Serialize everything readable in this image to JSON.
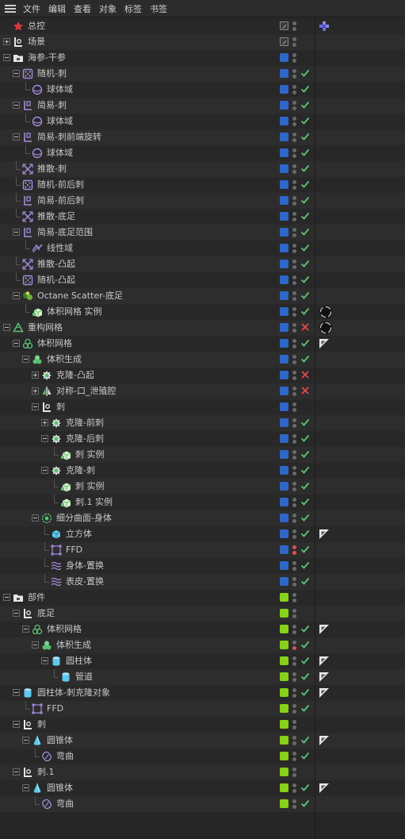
{
  "menu": [
    "文件",
    "编辑",
    "查看",
    "对象",
    "标签",
    "书签"
  ],
  "colors": {
    "layer_blue": "#2f67c8",
    "layer_green": "#88d11a",
    "check_green": "#58c878",
    "cross_red": "#e24b4b",
    "dot_red": "#e05050",
    "icon_purple": "#a58bdc",
    "icon_green": "#58c070",
    "icon_cyan": "#5ec9ee",
    "icon_red": "#d83a3a"
  },
  "rows": [
    {
      "label": "总控",
      "depth": 0,
      "exp": "none",
      "icon": "star-icon",
      "layer": "flag",
      "check": "none",
      "tag": "tag-dots-icon"
    },
    {
      "label": "场景",
      "depth": 0,
      "exp": "plus",
      "icon": "null-object-icon",
      "layer": "flag",
      "check": "none",
      "tag": ""
    },
    {
      "label": "海参-干参",
      "depth": 0,
      "exp": "minus",
      "icon": "folder-icon",
      "layer": "blue",
      "check": "none",
      "tag": ""
    },
    {
      "label": "随机-刺",
      "depth": 1,
      "exp": "minus",
      "icon": "random-effector-icon",
      "layer": "blue",
      "check": "check",
      "tag": ""
    },
    {
      "label": "球体域",
      "depth": 2,
      "exp": "none",
      "icon": "sphere-field-icon",
      "layer": "blue",
      "check": "check",
      "tag": ""
    },
    {
      "label": "简易-刺",
      "depth": 1,
      "exp": "minus",
      "icon": "plain-effector-icon",
      "layer": "blue",
      "check": "check",
      "tag": ""
    },
    {
      "label": "球体域",
      "depth": 2,
      "exp": "none",
      "icon": "sphere-field-icon",
      "layer": "blue",
      "check": "check",
      "tag": ""
    },
    {
      "label": "简易-刺前端旋转",
      "depth": 1,
      "exp": "minus",
      "icon": "plain-effector-icon",
      "layer": "blue",
      "check": "check",
      "tag": ""
    },
    {
      "label": "球体域",
      "depth": 2,
      "exp": "none",
      "icon": "sphere-field-icon",
      "layer": "blue",
      "check": "check",
      "tag": ""
    },
    {
      "label": "推散-刺",
      "depth": 1,
      "exp": "none",
      "icon": "push-apart-icon",
      "layer": "blue",
      "check": "check",
      "tag": ""
    },
    {
      "label": "随机-前后刺",
      "depth": 1,
      "exp": "none",
      "icon": "random-effector-icon",
      "layer": "blue",
      "check": "check",
      "tag": ""
    },
    {
      "label": "简易-前后刺",
      "depth": 1,
      "exp": "none",
      "icon": "plain-effector-icon",
      "layer": "blue",
      "check": "check",
      "tag": ""
    },
    {
      "label": "推散-底足",
      "depth": 1,
      "exp": "none",
      "icon": "push-apart-icon",
      "layer": "blue",
      "check": "check",
      "tag": ""
    },
    {
      "label": "简易-底足范围",
      "depth": 1,
      "exp": "minus",
      "icon": "plain-effector-icon",
      "layer": "blue",
      "check": "check",
      "tag": ""
    },
    {
      "label": "线性域",
      "depth": 2,
      "exp": "none",
      "icon": "linear-field-icon",
      "layer": "blue",
      "check": "check",
      "tag": ""
    },
    {
      "label": "推散-凸起",
      "depth": 1,
      "exp": "none",
      "icon": "push-apart-icon",
      "layer": "blue",
      "check": "check",
      "tag": ""
    },
    {
      "label": "随机-凸起",
      "depth": 1,
      "exp": "none",
      "icon": "random-effector-icon",
      "layer": "blue",
      "check": "check",
      "tag": ""
    },
    {
      "label": "Octane Scatter-底足",
      "depth": 1,
      "exp": "minus",
      "icon": "octane-scatter-icon",
      "layer": "blue",
      "check": "check",
      "tag": ""
    },
    {
      "label": "体积网格 实例",
      "depth": 2,
      "exp": "none",
      "icon": "instance-icon",
      "layer": "blue",
      "check": "check",
      "tag": "octane-object-tag-icon"
    },
    {
      "label": "重构网格",
      "depth": 0,
      "exp": "minus",
      "icon": "remesh-icon",
      "layer": "blue",
      "check": "cross",
      "tag": "octane-object-tag-icon"
    },
    {
      "label": "体积网格",
      "depth": 1,
      "exp": "minus",
      "icon": "volume-mesher-icon",
      "layer": "blue",
      "check": "check",
      "tag": "phong-tag-icon"
    },
    {
      "label": "体积生成",
      "depth": 2,
      "exp": "minus",
      "icon": "volume-builder-icon",
      "layer": "blue",
      "check": "check",
      "tag": ""
    },
    {
      "label": "克隆-凸起",
      "depth": 3,
      "exp": "plus",
      "icon": "cloner-icon",
      "layer": "blue",
      "check": "cross",
      "tag": ""
    },
    {
      "label": "对称-口_泄殖腔",
      "depth": 3,
      "exp": "plus",
      "icon": "symmetry-icon",
      "layer": "blue",
      "check": "cross",
      "tag": ""
    },
    {
      "label": "刺",
      "depth": 3,
      "exp": "minus",
      "icon": "null-object-icon",
      "layer": "blue",
      "check": "none",
      "tag": ""
    },
    {
      "label": "克隆-前刺",
      "depth": 4,
      "exp": "plus",
      "icon": "cloner-icon",
      "layer": "blue",
      "check": "check",
      "tag": ""
    },
    {
      "label": "克隆-后刺",
      "depth": 4,
      "exp": "minus",
      "icon": "cloner-icon",
      "layer": "blue",
      "check": "check",
      "tag": ""
    },
    {
      "label": "刺 实例",
      "depth": 5,
      "exp": "none",
      "icon": "instance-icon",
      "layer": "blue",
      "check": "check",
      "tag": ""
    },
    {
      "label": "克隆-刺",
      "depth": 4,
      "exp": "minus",
      "icon": "cloner-icon",
      "layer": "blue",
      "check": "check",
      "tag": ""
    },
    {
      "label": "刺 实例",
      "depth": 5,
      "exp": "none",
      "icon": "instance-icon",
      "layer": "blue",
      "check": "check",
      "tag": ""
    },
    {
      "label": "刺.1 实例",
      "depth": 5,
      "exp": "none",
      "icon": "instance-icon",
      "layer": "blue",
      "check": "check",
      "tag": ""
    },
    {
      "label": "细分曲面-身体",
      "depth": 3,
      "exp": "minus",
      "icon": "subdivision-surface-icon",
      "layer": "blue",
      "check": "check",
      "tag": ""
    },
    {
      "label": "立方体",
      "depth": 4,
      "exp": "none",
      "icon": "cube-icon",
      "layer": "blue",
      "check": "check",
      "tag": "phong-tag-icon"
    },
    {
      "label": "FFD",
      "depth": 4,
      "exp": "none",
      "icon": "ffd-icon",
      "layer": "blue",
      "check": "check",
      "tag": "",
      "dots": "red"
    },
    {
      "label": "身体-置换",
      "depth": 4,
      "exp": "none",
      "icon": "displacer-icon",
      "layer": "blue",
      "check": "check",
      "tag": ""
    },
    {
      "label": "表皮-置换",
      "depth": 4,
      "exp": "none",
      "icon": "displacer-icon",
      "layer": "blue",
      "check": "check",
      "tag": ""
    },
    {
      "label": "部件",
      "depth": 0,
      "exp": "minus",
      "icon": "folder-icon",
      "layer": "green",
      "check": "none",
      "tag": ""
    },
    {
      "label": "底足",
      "depth": 1,
      "exp": "minus",
      "icon": "null-object-icon",
      "layer": "green",
      "check": "none",
      "tag": ""
    },
    {
      "label": "体积网格",
      "depth": 2,
      "exp": "minus",
      "icon": "volume-mesher-icon",
      "layer": "green",
      "check": "check",
      "tag": "phong-tag-icon"
    },
    {
      "label": "体积生成",
      "depth": 3,
      "exp": "minus",
      "icon": "volume-builder-icon",
      "layer": "green",
      "check": "check",
      "tag": "",
      "dots": "redbot"
    },
    {
      "label": "圆柱体",
      "depth": 4,
      "exp": "minus",
      "icon": "cylinder-icon",
      "layer": "green",
      "check": "check",
      "tag": "phong-tag-icon"
    },
    {
      "label": "管道",
      "depth": 5,
      "exp": "none",
      "icon": "cylinder-icon",
      "layer": "green",
      "check": "check",
      "tag": "phong-tag-icon"
    },
    {
      "label": "圆柱体-刺克隆对象",
      "depth": 1,
      "exp": "minus",
      "icon": "cylinder-icon",
      "layer": "green",
      "check": "check",
      "tag": "phong-tag-icon"
    },
    {
      "label": "FFD",
      "depth": 2,
      "exp": "none",
      "icon": "ffd-icon",
      "layer": "green",
      "check": "check",
      "tag": ""
    },
    {
      "label": "刺",
      "depth": 1,
      "exp": "minus",
      "icon": "null-object-icon",
      "layer": "green",
      "check": "none",
      "tag": ""
    },
    {
      "label": "圆锥体",
      "depth": 2,
      "exp": "minus",
      "icon": "cone-icon",
      "layer": "green",
      "check": "check",
      "tag": "phong-tag-icon"
    },
    {
      "label": "弯曲",
      "depth": 3,
      "exp": "none",
      "icon": "bend-icon",
      "layer": "green",
      "check": "check",
      "tag": ""
    },
    {
      "label": "刺.1",
      "depth": 1,
      "exp": "minus",
      "icon": "null-object-icon",
      "layer": "green",
      "check": "none",
      "tag": ""
    },
    {
      "label": "圆锥体",
      "depth": 2,
      "exp": "minus",
      "icon": "cone-icon",
      "layer": "green",
      "check": "check",
      "tag": "phong-tag-icon"
    },
    {
      "label": "弯曲",
      "depth": 3,
      "exp": "none",
      "icon": "bend-icon",
      "layer": "green",
      "check": "check",
      "tag": ""
    }
  ]
}
